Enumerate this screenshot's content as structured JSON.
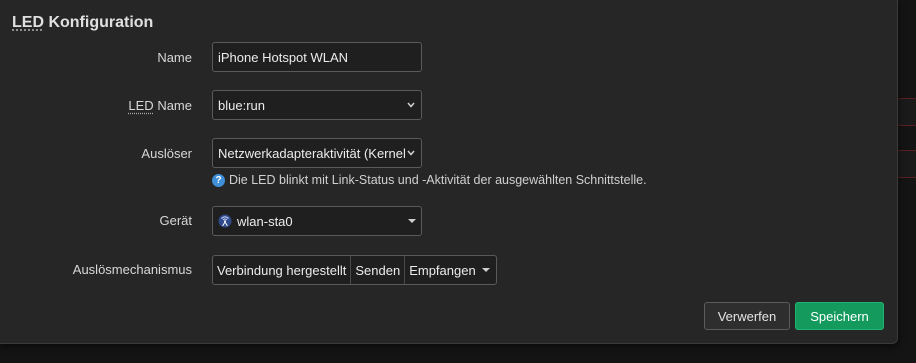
{
  "dialog": {
    "title_abbr": "LED",
    "title_rest": " Konfiguration"
  },
  "fields": {
    "name": {
      "label": "Name",
      "value": "iPhone Hotspot WLAN"
    },
    "led_name": {
      "label_abbr": "LED",
      "label_rest": " Name",
      "value": "blue:run"
    },
    "trigger": {
      "label": "Auslöser",
      "value": "Netzwerkadapteraktivität (Kernel",
      "description": "Die LED blinkt mit Link-Status und -Aktivität der ausgewählten Schnittstelle."
    },
    "device": {
      "label": "Gerät",
      "value": "wlan-sta0"
    },
    "trigger_mechanism": {
      "label": "Auslösmechanismus",
      "options": [
        "Verbindung hergestellt",
        "Senden",
        "Empfangen"
      ]
    }
  },
  "buttons": {
    "cancel": "Verwerfen",
    "save": "Speichern"
  },
  "colors": {
    "save_button": "#159a5e",
    "help_icon": "#3e8ed8"
  },
  "icons": {
    "help": "question-circle-icon",
    "device": "wireless-antenna-icon"
  }
}
